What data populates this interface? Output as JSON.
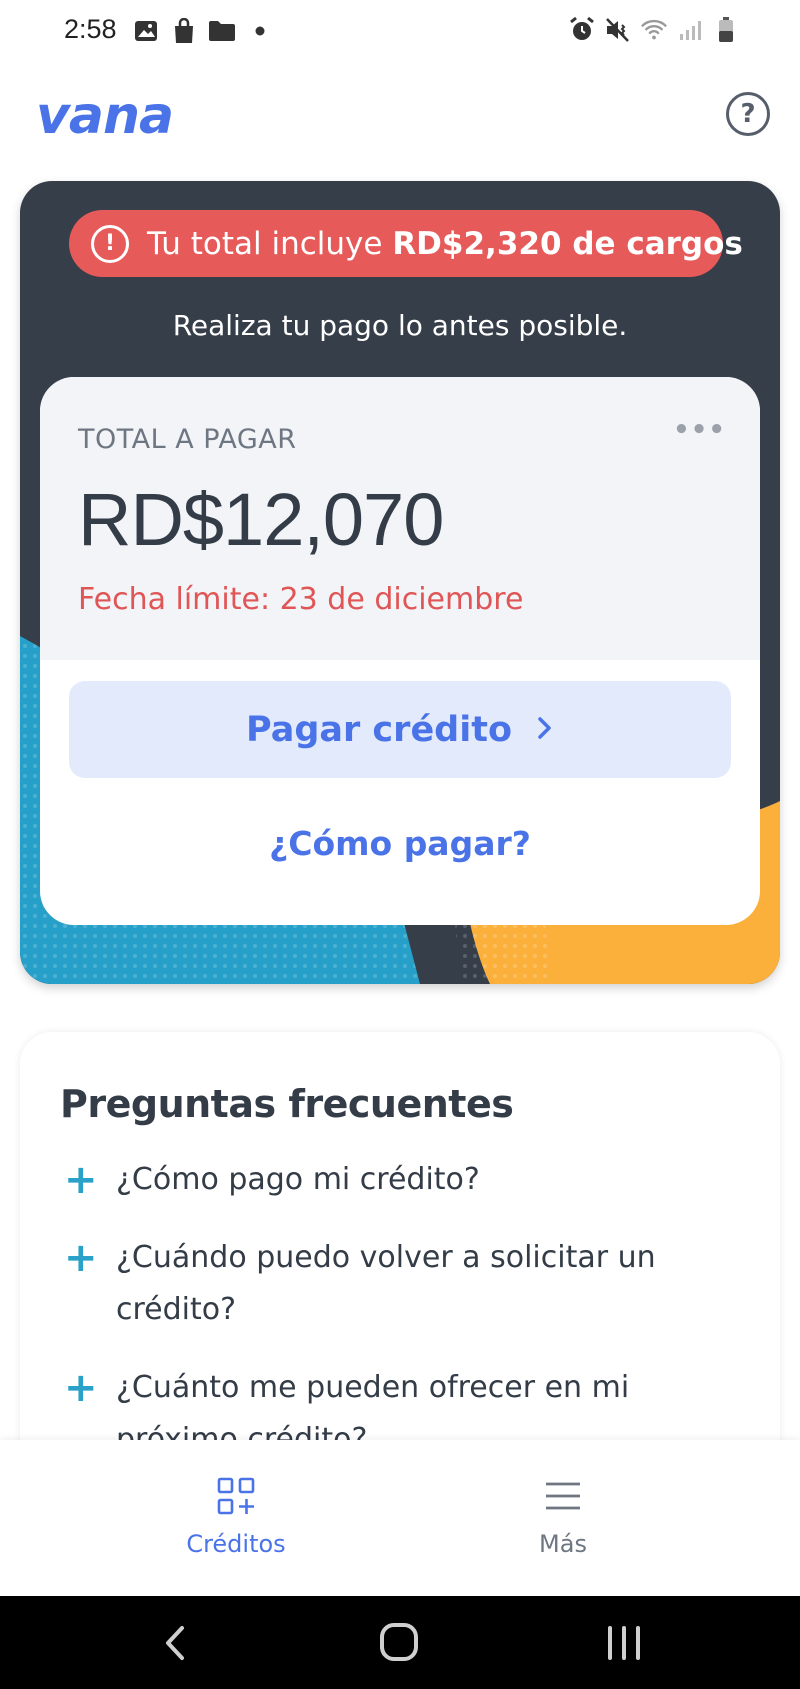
{
  "status_bar": {
    "time": "2:58"
  },
  "header": {
    "logo_text": "vana",
    "help_symbol": "?"
  },
  "hero": {
    "alert_prefix": "Tu total incluye ",
    "alert_amount": "RD$2,320 de cargos",
    "subtitle": "Realiza tu pago lo antes posible.",
    "total_label": "TOTAL A PAGAR",
    "total_amount": "RD$12,070",
    "deadline": "Fecha límite: 23 de diciembre",
    "pay_button_label": "Pagar crédito",
    "how_to_pay_link": "¿Cómo pagar?"
  },
  "faq": {
    "title": "Preguntas frecuentes",
    "items": [
      {
        "question": "¿Cómo pago mi crédito?"
      },
      {
        "question": "¿Cuándo puedo volver a solicitar un crédito?"
      },
      {
        "question": "¿Cuánto me pueden ofrecer en mi próximo crédito?"
      }
    ]
  },
  "bottom_nav": {
    "items": [
      {
        "label": "Créditos",
        "icon": "grid-plus-icon",
        "active": true
      },
      {
        "label": "Más",
        "icon": "menu-icon",
        "active": false
      }
    ]
  },
  "colors": {
    "brand_blue": "#4a73e8",
    "hero_dark": "#363e49",
    "alert_red": "#e65a5a",
    "deadline_red": "#e05555",
    "accent_teal": "#2aa1c8",
    "accent_yellow": "#fbb03b",
    "accent_cyan": "#26a0c9"
  }
}
